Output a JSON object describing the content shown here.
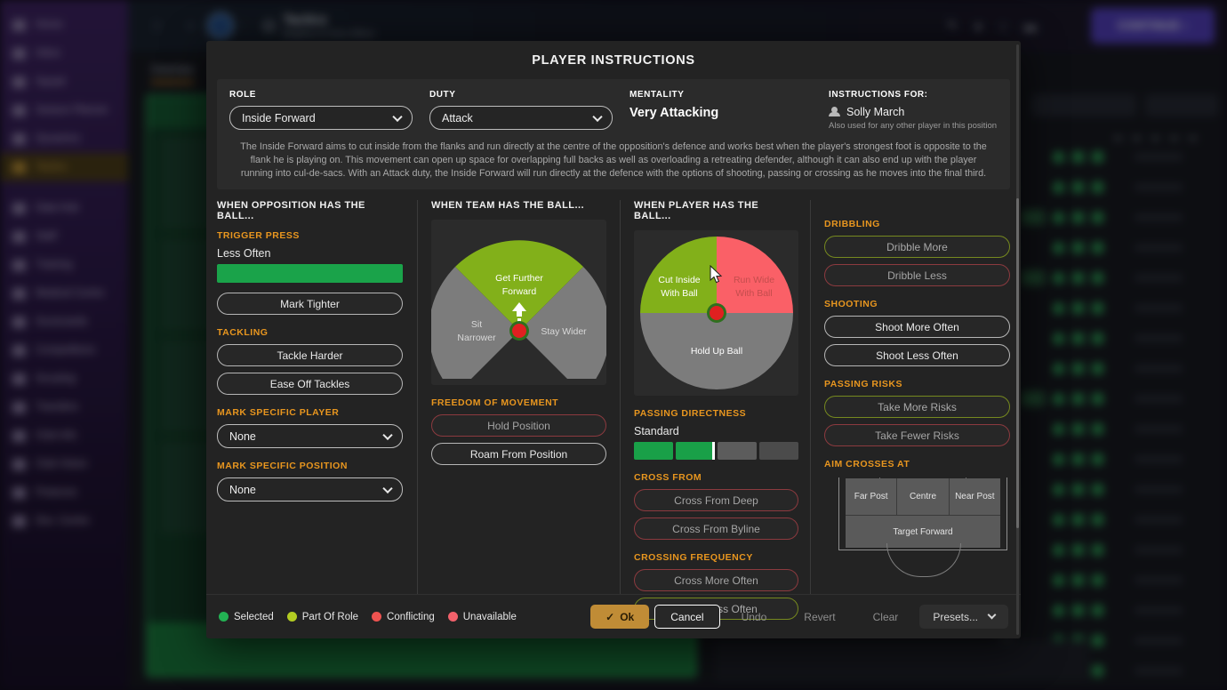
{
  "background": {
    "sidebar_items": [
      {
        "label": "Home",
        "icon": "home-icon",
        "active": false
      },
      {
        "label": "Inbox",
        "icon": "inbox-icon",
        "active": false
      },
      {
        "label": "Squad",
        "icon": "shirt-icon",
        "active": false
      },
      {
        "label": "Season Planner",
        "icon": "calendar-icon",
        "active": false
      },
      {
        "label": "Dynamics",
        "icon": "dynamics-icon",
        "active": false
      },
      {
        "label": "Tactics",
        "icon": "tactics-icon",
        "active": true
      },
      {
        "label": "Data Hub",
        "icon": "data-hub-icon",
        "active": false
      },
      {
        "label": "Staff",
        "icon": "staff-icon",
        "active": false
      },
      {
        "label": "Training",
        "icon": "training-icon",
        "active": false
      },
      {
        "label": "Medical Centre",
        "icon": "medical-icon",
        "active": false
      },
      {
        "label": "Scorecards",
        "icon": "scorecards-icon",
        "active": false
      },
      {
        "label": "Competitions",
        "icon": "trophy-icon",
        "active": false
      },
      {
        "label": "Scouting",
        "icon": "magnifier-icon",
        "active": false
      },
      {
        "label": "Transfers",
        "icon": "transfers-icon",
        "active": false
      },
      {
        "label": "Club Info",
        "icon": "shield-icon",
        "active": false
      },
      {
        "label": "Club Vision",
        "icon": "vision-icon",
        "active": false
      },
      {
        "label": "Finances",
        "icon": "finances-icon",
        "active": false
      },
      {
        "label": "Dev. Centre",
        "icon": "dev-centre-icon",
        "active": false
      }
    ],
    "topbar": {
      "back_arrow": "‹",
      "forward_arrow": "›",
      "title": "Tactics",
      "subtitle": "Brighton & Hove Albion",
      "continue_label": "CONTINUE",
      "continue_arrow": "›",
      "balance": "",
      "wage": ""
    },
    "tab_label": "Overview",
    "filters": [
      "Quick Pick",
      "Filter"
    ]
  },
  "modal": {
    "title": "PLAYER INSTRUCTIONS",
    "role": {
      "label": "ROLE",
      "value": "Inside Forward"
    },
    "duty": {
      "label": "DUTY",
      "value": "Attack"
    },
    "mentality": {
      "label": "MENTALITY",
      "value": "Very Attacking"
    },
    "instructions_for": {
      "label": "INSTRUCTIONS FOR:",
      "player": "Solly March",
      "note": "Also used for any other player in this position"
    },
    "role_description": "The Inside Forward aims to cut inside from the flanks and run directly at the centre of the opposition's defence and works best when the player's strongest foot is opposite to the flank he is playing on. This movement can open up space for overlapping full backs as well as overloading a retreating defender, although it can also end up with the player running into cul-de-sacs. With an Attack duty, the Inside Forward will run directly at the defence with the options of shooting, passing or crossing as he moves into the final third.",
    "col_opposition": {
      "heading": "WHEN OPPOSITION HAS THE BALL...",
      "trigger_press": {
        "heading": "TRIGGER PRESS",
        "value": "Less Often",
        "fill_percent": 100
      },
      "mark_tighter": {
        "label": "Mark Tighter",
        "state": "default"
      },
      "tackling": {
        "heading": "TACKLING",
        "options": [
          {
            "label": "Tackle Harder",
            "state": "default"
          },
          {
            "label": "Ease Off Tackles",
            "state": "default"
          }
        ]
      },
      "mark_specific_player": {
        "heading": "MARK SPECIFIC PLAYER",
        "value": "None"
      },
      "mark_specific_position": {
        "heading": "MARK SPECIFIC POSITION",
        "value": "None"
      }
    },
    "col_team": {
      "heading": "WHEN TEAM HAS THE BALL...",
      "wheel": {
        "top": {
          "label": "Get Further Forward",
          "state": "part-of-role"
        },
        "left": {
          "label": "Sit Narrower",
          "state": "default"
        },
        "right": {
          "label": "Stay Wider",
          "state": "default"
        },
        "centre_dot": "red"
      },
      "freedom_of_movement": {
        "heading": "FREEDOM OF MOVEMENT",
        "options": [
          {
            "label": "Hold Position",
            "state": "conflicting"
          },
          {
            "label": "Roam From Position",
            "state": "default"
          }
        ]
      }
    },
    "col_player": {
      "heading": "WHEN PLAYER HAS THE BALL...",
      "wheel": {
        "top_left": {
          "label": "Cut Inside With Ball",
          "state": "part-of-role"
        },
        "top_right": {
          "label": "Run Wide With Ball",
          "state": "unavailable"
        },
        "bottom": {
          "label": "Hold Up Ball",
          "state": "default"
        },
        "centre_dot": "red"
      },
      "passing_directness": {
        "heading": "PASSING DIRECTNESS",
        "value": "Standard",
        "segments": [
          "on",
          "on",
          "mid",
          "off"
        ]
      },
      "cross_from": {
        "heading": "CROSS FROM",
        "options": [
          {
            "label": "Cross From Deep",
            "state": "conflicting"
          },
          {
            "label": "Cross From Byline",
            "state": "conflicting"
          }
        ]
      },
      "crossing_frequency": {
        "heading": "CROSSING FREQUENCY",
        "options": [
          {
            "label": "Cross More Often",
            "state": "conflicting"
          },
          {
            "label": "Cross Less Often",
            "state": "part-of-role"
          }
        ]
      }
    },
    "col_extra": {
      "dribbling": {
        "heading": "DRIBBLING",
        "options": [
          {
            "label": "Dribble More",
            "state": "part-of-role"
          },
          {
            "label": "Dribble Less",
            "state": "conflicting"
          }
        ]
      },
      "shooting": {
        "heading": "SHOOTING",
        "options": [
          {
            "label": "Shoot More Often",
            "state": "default"
          },
          {
            "label": "Shoot Less Often",
            "state": "default"
          }
        ]
      },
      "passing_risks": {
        "heading": "PASSING RISKS",
        "options": [
          {
            "label": "Take More Risks",
            "state": "part-of-role"
          },
          {
            "label": "Take Fewer Risks",
            "state": "conflicting"
          }
        ]
      },
      "aim_crosses_at": {
        "heading": "AIM CROSSES AT",
        "zones": [
          "Far Post",
          "Centre",
          "Near Post"
        ],
        "target": "Target Forward"
      }
    },
    "legend": [
      {
        "label": "Selected",
        "color": "#23b153"
      },
      {
        "label": "Part Of Role",
        "color": "#b3cc22"
      },
      {
        "label": "Conflicting",
        "color": "#ef5350"
      },
      {
        "label": "Unavailable",
        "color": "#f2616b"
      }
    ],
    "actions": {
      "ok": "Ok",
      "ok_check": "✓",
      "cancel": "Cancel",
      "undo": "Undo",
      "revert": "Revert",
      "clear": "Clear",
      "presets": "Presets..."
    }
  },
  "colors": {
    "accent_orange": "#e8961f",
    "selected_green": "#23b153",
    "part_of_role": "#b3cc22",
    "conflicting": "#ef5350",
    "ok_gold": "#c08c36"
  }
}
